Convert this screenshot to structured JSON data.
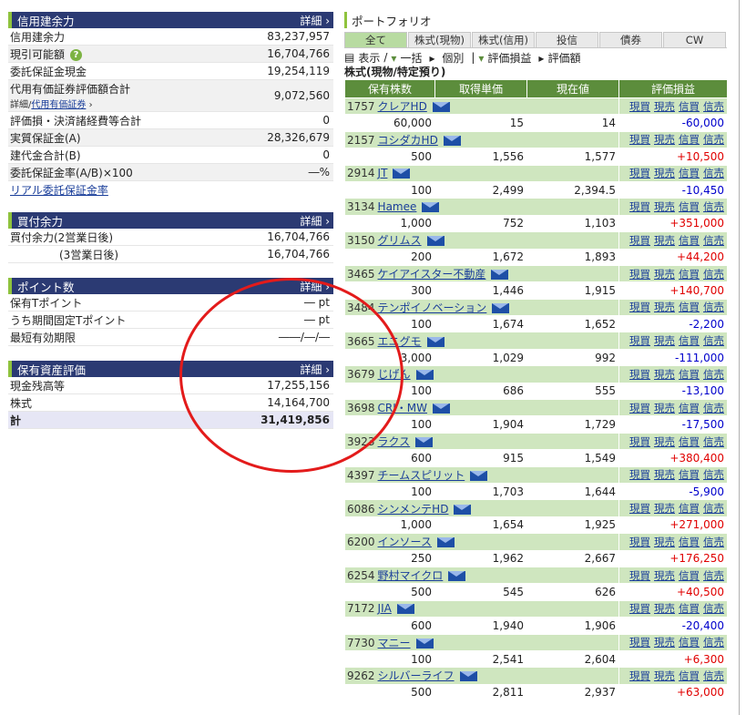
{
  "left": {
    "credit": {
      "title": "信用建余力",
      "detail": "詳細",
      "rows": [
        {
          "label": "信用建余力",
          "value": "83,237,957"
        },
        {
          "label": "現引可能額",
          "value": "16,704,766"
        },
        {
          "label": "委託保証金現金",
          "value": "19,254,119"
        },
        {
          "label": "代用有価証券評価額合計",
          "sub_prefix": "詳細/",
          "sub_link": "代用有価証券",
          "value": "9,072,560"
        },
        {
          "label": "評価損・決済諸経費等合計",
          "value": "0"
        },
        {
          "label": "実質保証金(A)",
          "value": "28,326,679"
        },
        {
          "label": "建代金合計(B)",
          "value": "0"
        },
        {
          "label": "委託保証金率(A/B)×100",
          "value": "―%"
        }
      ],
      "link": "リアル委託保証金率"
    },
    "buy": {
      "title": "買付余力",
      "detail": "詳細",
      "rows": [
        {
          "label": "買付余力(2営業日後)",
          "value": "16,704,766"
        },
        {
          "label": "(3営業日後)",
          "value": "16,704,766"
        }
      ]
    },
    "points": {
      "title": "ポイント数",
      "detail": "詳細",
      "rows": [
        {
          "label": "保有Tポイント",
          "value": "― pt"
        },
        {
          "label": "うち期間固定Tポイント",
          "value": "― pt"
        },
        {
          "label": "最短有効期限",
          "value": "――/―/―"
        }
      ]
    },
    "assets": {
      "title": "保有資産評価",
      "detail": "詳細",
      "rows": [
        {
          "label": "現金残高等",
          "value": "17,255,156"
        },
        {
          "label": "株式",
          "value": "14,164,700"
        },
        {
          "label": "計",
          "value": "31,419,856"
        }
      ]
    }
  },
  "right": {
    "title": "ポートフォリオ",
    "tabs": [
      "全て",
      "株式(現物)",
      "株式(信用)",
      "投信",
      "債券",
      "CW"
    ],
    "toolbar": {
      "display": "表示",
      "sep": "/",
      "bulk": "一括",
      "each": "個別",
      "pl": "評価損益",
      "val": "評価額"
    },
    "subtitle": "株式(現物/特定預り)",
    "headers": [
      "保有株数",
      "取得単価",
      "現在値",
      "評価損益"
    ],
    "actions": [
      "現買",
      "現売",
      "信買",
      "信売"
    ],
    "holdings": [
      {
        "code": "1757",
        "name": "クレアHD",
        "qty": "60,000",
        "cost": "15",
        "price": "14",
        "pl": "-60,000",
        "sign": "neg"
      },
      {
        "code": "2157",
        "name": "コシダカHD",
        "qty": "500",
        "cost": "1,556",
        "price": "1,577",
        "pl": "+10,500",
        "sign": "pos"
      },
      {
        "code": "2914",
        "name": "JT",
        "qty": "100",
        "cost": "2,499",
        "price": "2,394.5",
        "pl": "-10,450",
        "sign": "neg"
      },
      {
        "code": "3134",
        "name": "Hamee",
        "qty": "1,000",
        "cost": "752",
        "price": "1,103",
        "pl": "+351,000",
        "sign": "pos"
      },
      {
        "code": "3150",
        "name": "グリムス",
        "qty": "200",
        "cost": "1,672",
        "price": "1,893",
        "pl": "+44,200",
        "sign": "pos"
      },
      {
        "code": "3465",
        "name": "ケイアイスター不動産",
        "qty": "300",
        "cost": "1,446",
        "price": "1,915",
        "pl": "+140,700",
        "sign": "pos"
      },
      {
        "code": "3484",
        "name": "テンポイノベーション",
        "qty": "100",
        "cost": "1,674",
        "price": "1,652",
        "pl": "-2,200",
        "sign": "neg"
      },
      {
        "code": "3665",
        "name": "エニグモ",
        "qty": "3,000",
        "cost": "1,029",
        "price": "992",
        "pl": "-111,000",
        "sign": "neg"
      },
      {
        "code": "3679",
        "name": "じげん",
        "qty": "100",
        "cost": "686",
        "price": "555",
        "pl": "-13,100",
        "sign": "neg"
      },
      {
        "code": "3698",
        "name": "CRI・MW",
        "qty": "100",
        "cost": "1,904",
        "price": "1,729",
        "pl": "-17,500",
        "sign": "neg"
      },
      {
        "code": "3923",
        "name": "ラクス",
        "qty": "600",
        "cost": "915",
        "price": "1,549",
        "pl": "+380,400",
        "sign": "pos"
      },
      {
        "code": "4397",
        "name": "チームスピリット",
        "qty": "100",
        "cost": "1,703",
        "price": "1,644",
        "pl": "-5,900",
        "sign": "neg"
      },
      {
        "code": "6086",
        "name": "シンメンテHD",
        "qty": "1,000",
        "cost": "1,654",
        "price": "1,925",
        "pl": "+271,000",
        "sign": "pos"
      },
      {
        "code": "6200",
        "name": "インソース",
        "qty": "250",
        "cost": "1,962",
        "price": "2,667",
        "pl": "+176,250",
        "sign": "pos"
      },
      {
        "code": "6254",
        "name": "野村マイクロ",
        "qty": "500",
        "cost": "545",
        "price": "626",
        "pl": "+40,500",
        "sign": "pos"
      },
      {
        "code": "7172",
        "name": "JIA",
        "qty": "600",
        "cost": "1,940",
        "price": "1,906",
        "pl": "-20,400",
        "sign": "neg"
      },
      {
        "code": "7730",
        "name": "マニー",
        "qty": "100",
        "cost": "2,541",
        "price": "2,604",
        "pl": "+6,300",
        "sign": "pos"
      },
      {
        "code": "9262",
        "name": "シルバーライフ",
        "qty": "500",
        "cost": "2,811",
        "price": "2,937",
        "pl": "+63,000",
        "sign": "pos"
      }
    ]
  },
  "colors": {
    "header_navy": "#2b3a73",
    "accent_green": "#8fc33d",
    "table_header": "#5c8d3c",
    "positive": "#e00000",
    "negative": "#0000cc",
    "annotation_circle": "#e31b1b"
  }
}
